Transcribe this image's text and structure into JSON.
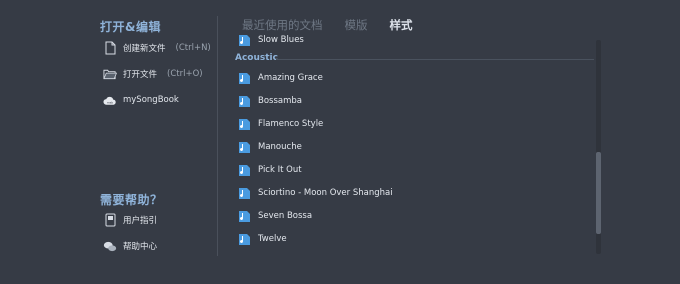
{
  "sidebar": {
    "open_edit_title": "打开&编辑",
    "items": [
      {
        "label": "创建新文件",
        "shortcut": "(Ctrl+N)",
        "icon": "new-file-icon"
      },
      {
        "label": "打开文件",
        "shortcut": "(Ctrl+O)",
        "icon": "folder-icon"
      },
      {
        "label": "mySongBook",
        "shortcut": "",
        "icon": "cloud-icon"
      }
    ],
    "help_title": "需要帮助？",
    "help_items": [
      {
        "label": "用户指引",
        "icon": "book-icon"
      },
      {
        "label": "帮助中心",
        "icon": "chat-bubbles-icon"
      }
    ]
  },
  "tabs": [
    "最近使用的文档",
    "模版",
    "样式"
  ],
  "active_tab": "样式",
  "list": {
    "cut_top_item": "Slow Blues",
    "group": "Acoustic",
    "items": [
      "Amazing Grace",
      "Bossamba",
      "Flamenco Style",
      "Manouche",
      "Pick It Out",
      "Sciortino - Moon Over Shanghai",
      "Seven Bossa",
      "Twelve"
    ]
  },
  "colors": {
    "background": "#363b45",
    "accent": "#8fb3d9",
    "file_icon": "#4a9be0"
  }
}
